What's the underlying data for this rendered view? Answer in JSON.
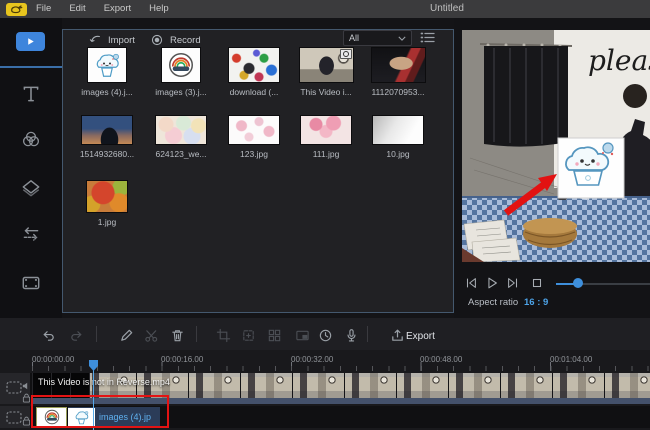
{
  "window": {
    "title": "Untitled",
    "menu": [
      "File",
      "Edit",
      "Export",
      "Help"
    ]
  },
  "media_panel": {
    "import_label": "Import",
    "record_label": "Record",
    "filter_dropdown_value": "All",
    "items": [
      {
        "name": "images (4).j..."
      },
      {
        "name": "images (3).j..."
      },
      {
        "name": "download (..."
      },
      {
        "name": "This Video i..."
      },
      {
        "name": "1112070953..."
      },
      {
        "name": "1514932680..."
      },
      {
        "name": "624123_we..."
      },
      {
        "name": "123.jpg"
      },
      {
        "name": "111.jpg"
      },
      {
        "name": "10.jpg"
      },
      {
        "name": "1.jpg"
      }
    ]
  },
  "preview": {
    "whiteboard_text": "pleas",
    "aspect_ratio_label": "Aspect ratio",
    "aspect_ratio_value": "16 : 9"
  },
  "toolbar": {
    "export_label": "Export"
  },
  "timeline": {
    "ruler": [
      "00:00:00.00",
      "00:00:16.00",
      "00:00:32.00",
      "00:00:48.00",
      "00:01:04.00"
    ],
    "track1_clip_label": "This Video is not in Reverse.mp4",
    "track2_clip_label": "images (4).jp"
  },
  "icons": [
    "bee-logo",
    "import-icon",
    "record-icon",
    "chevron-down-icon",
    "list-view-icon",
    "media-tab-icon",
    "text-tab-icon",
    "filters-tab-icon",
    "elements-tab-icon",
    "transitions-tab-icon",
    "footage-tab-icon",
    "undo-icon",
    "redo-icon",
    "edit-pencil-icon",
    "split-scissors-icon",
    "delete-trash-icon",
    "crop-icon",
    "zoom-icon",
    "mosaic-icon",
    "pip-icon",
    "duration-clock-icon",
    "voiceover-mic-icon",
    "export-icon",
    "prev-frame-icon",
    "play-icon",
    "next-frame-icon",
    "stop-icon",
    "clip-track-icon",
    "speaker-icon",
    "lock-icon",
    "camera-badge-icon"
  ],
  "colors": {
    "accent_blue": "#3e85dc",
    "annotation_red": "#e21414",
    "selected_clip_blue": "#2b3c58",
    "aspect_value_blue": "#4da3e8",
    "logo_yellow": "#e8c51e"
  }
}
